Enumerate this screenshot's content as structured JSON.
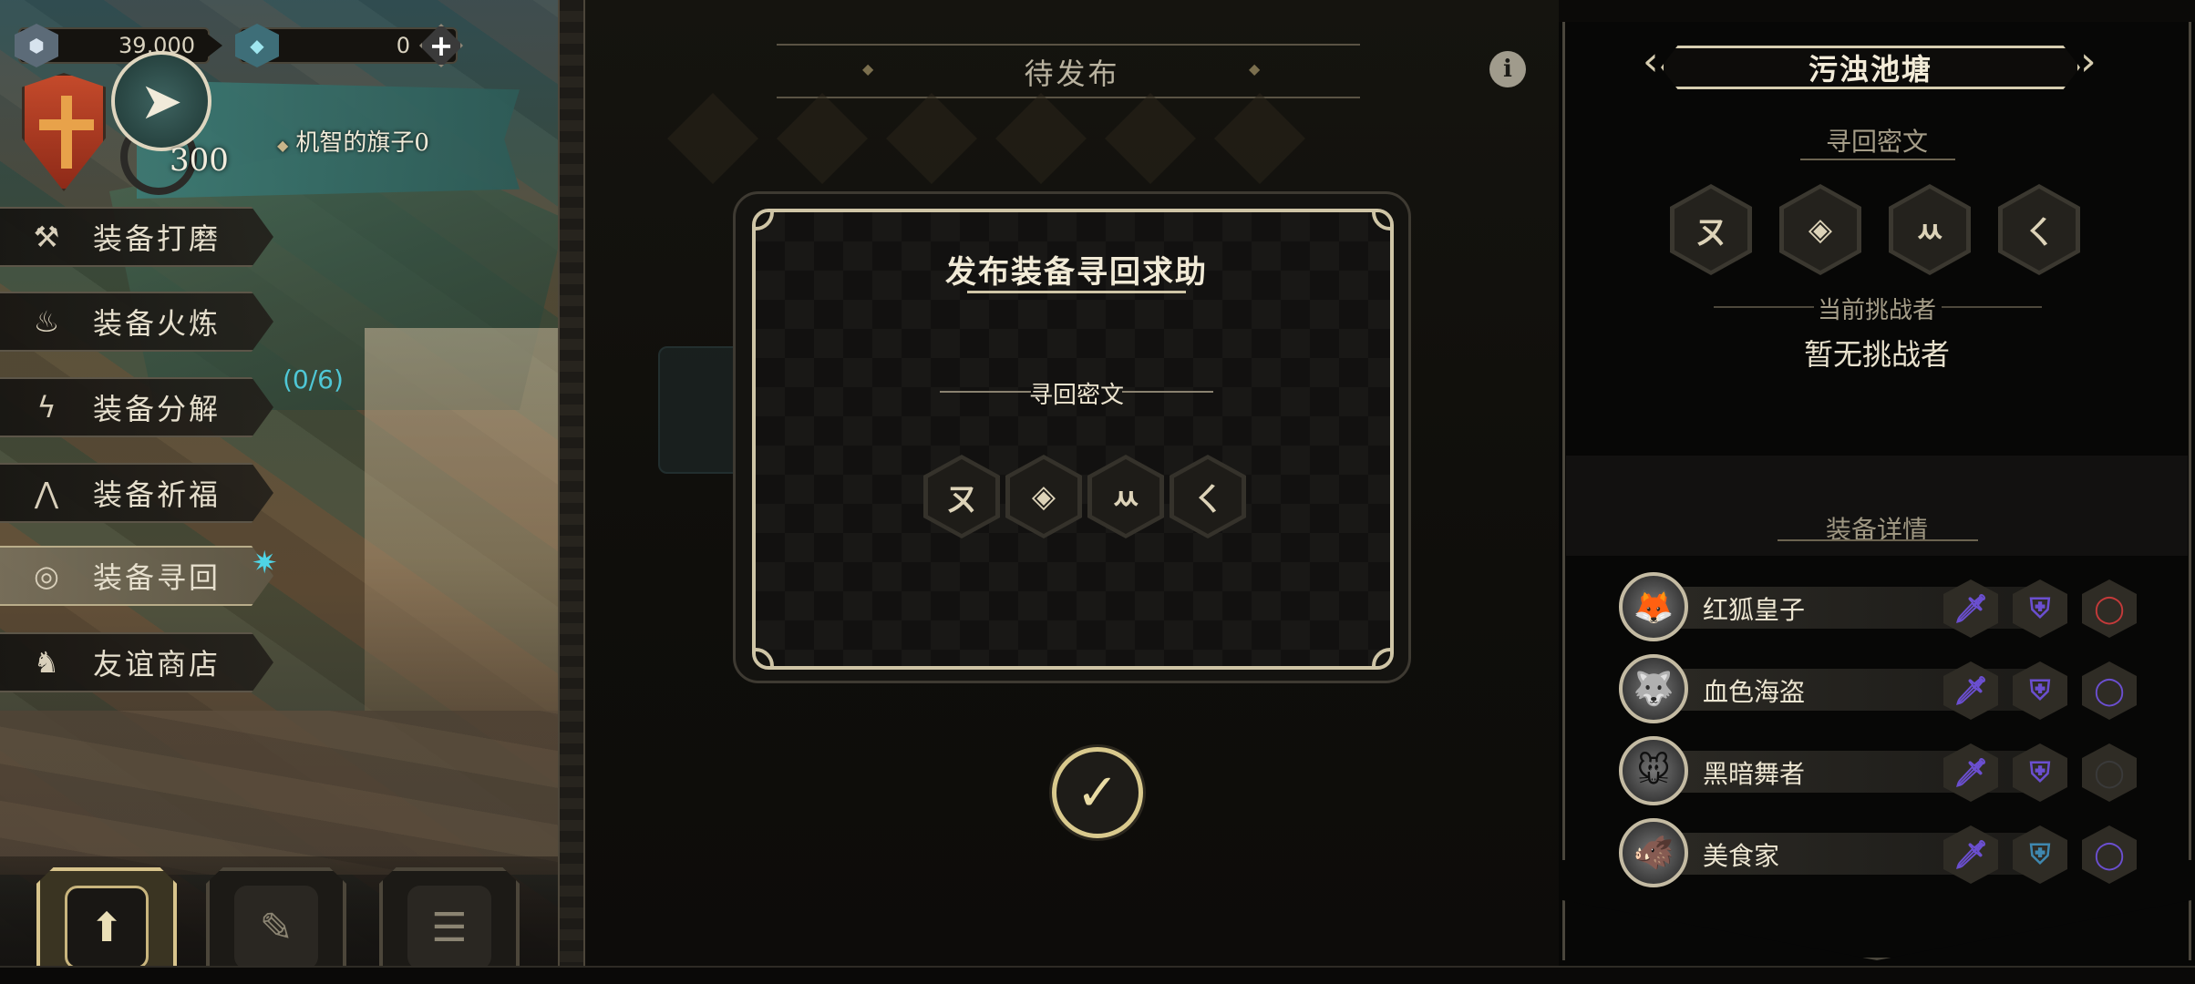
{
  "currencies": [
    {
      "name": "cube-currency",
      "icon": "cube-icon",
      "value": "39,000"
    },
    {
      "name": "crystal-currency",
      "icon": "crystal-icon",
      "value": "0"
    }
  ],
  "banner": {
    "label": "机智的旗子0",
    "medal_count": "300"
  },
  "menu": [
    {
      "id": "polish",
      "label": "装备打磨",
      "icon": "hammer-icon"
    },
    {
      "id": "fire",
      "label": "装备火炼",
      "icon": "flame-icon"
    },
    {
      "id": "decompose",
      "label": "装备分解",
      "icon": "lightning-icon"
    },
    {
      "id": "bless",
      "label": "装备祈福",
      "icon": "pray-hands-icon"
    },
    {
      "id": "recover",
      "label": "装备寻回",
      "icon": "target-icon"
    },
    {
      "id": "shop",
      "label": "友谊商店",
      "icon": "fox-icon"
    }
  ],
  "decompose_counter": "(0/6)",
  "center": {
    "title": "待发布"
  },
  "dialog": {
    "title": "发布装备寻回求助",
    "cipher_label": "寻回密文",
    "runes": [
      "ㄡ",
      "◈",
      "ㅆ",
      "ㄑ"
    ]
  },
  "right": {
    "map_name": "污浊池塘",
    "cipher_label": "寻回密文",
    "runes": [
      "ㄡ",
      "◈",
      "ㅆ",
      "ㄑ"
    ],
    "challenger_label": "当前挑战者",
    "challenger_value": "暂无挑战者",
    "details_label": "装备详情",
    "heroes": [
      {
        "name": "红狐皇子",
        "avatar": "fox-avatar",
        "gear": [
          {
            "icon": "sword-icon",
            "color": "#6b4fd0"
          },
          {
            "icon": "armor-icon",
            "color": "#6b4fd0"
          },
          {
            "icon": "ring-icon",
            "color": "#c43a3a"
          }
        ]
      },
      {
        "name": "血色海盗",
        "avatar": "wolf-avatar",
        "gear": [
          {
            "icon": "sword-icon",
            "color": "#6b4fd0"
          },
          {
            "icon": "armor-icon",
            "color": "#6b4fd0"
          },
          {
            "icon": "ring-icon",
            "color": "#6b4fd0"
          }
        ]
      },
      {
        "name": "黑暗舞者",
        "avatar": "mouse-avatar",
        "gear": [
          {
            "icon": "sword-icon",
            "color": "#6b4fd0"
          },
          {
            "icon": "armor-icon",
            "color": "#6b4fd0"
          },
          {
            "icon": "ring-icon",
            "color": "#3a3a3a"
          }
        ]
      },
      {
        "name": "美食家",
        "avatar": "boar-avatar",
        "gear": [
          {
            "icon": "sword-icon",
            "color": "#6b4fd0"
          },
          {
            "icon": "armor-icon",
            "color": "#3f88b0"
          },
          {
            "icon": "ring-icon",
            "color": "#6b4fd0"
          }
        ]
      }
    ]
  },
  "colors": {
    "accent": "#cfc5a6",
    "cyan": "#4fc7d6",
    "panel": "#141310"
  }
}
